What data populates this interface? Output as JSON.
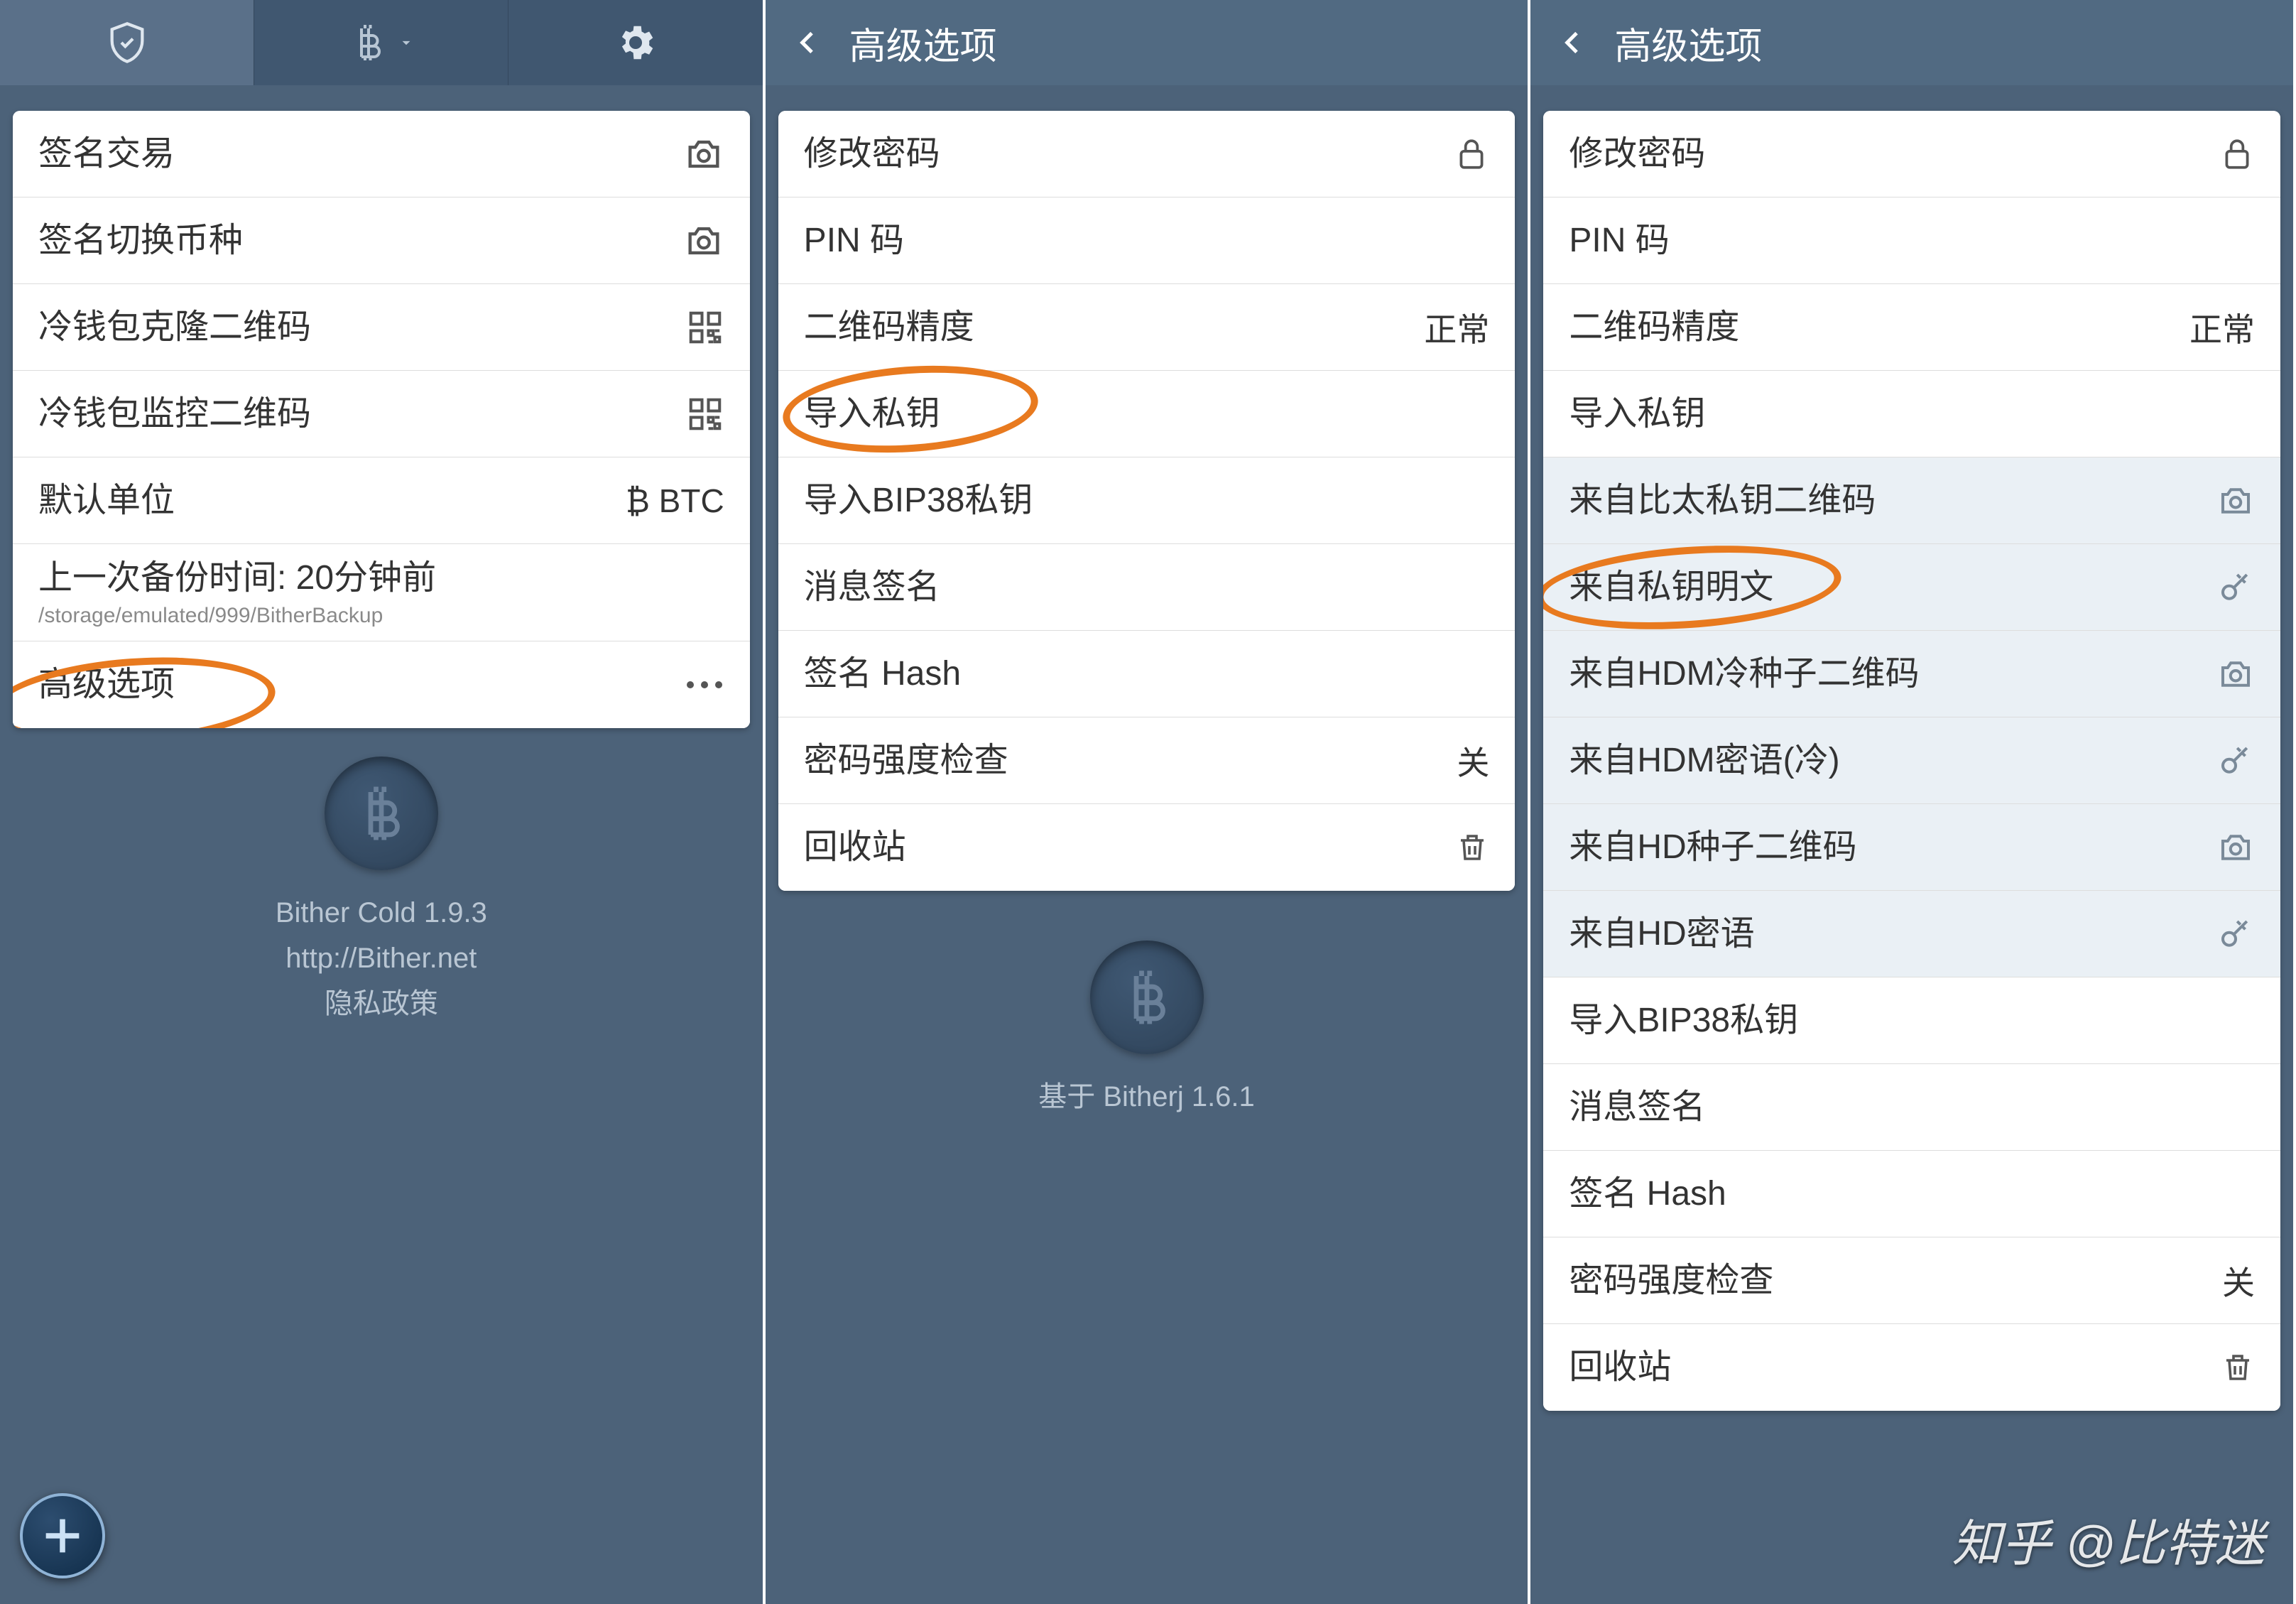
{
  "panel1": {
    "rows": [
      {
        "label": "签名交易",
        "icon": "camera"
      },
      {
        "label": "签名切换币种",
        "icon": "camera"
      },
      {
        "label": "冷钱包克隆二维码",
        "icon": "qr"
      },
      {
        "label": "冷钱包监控二维码",
        "icon": "qr"
      },
      {
        "label": "默认单位",
        "value": "₿ BTC"
      },
      {
        "label": "上一次备份时间: 20分钟前",
        "sublabel": "/storage/emulated/999/BitherBackup"
      },
      {
        "label": "高级选项",
        "icon": "dots"
      }
    ],
    "footer": {
      "app_name": "Bither Cold 1.9.3",
      "url": "http://Bither.net",
      "privacy": "隐私政策"
    }
  },
  "panel2": {
    "title": "高级选项",
    "rows": [
      {
        "label": "修改密码",
        "icon": "lock"
      },
      {
        "label": "PIN 码"
      },
      {
        "label": "二维码精度",
        "value": "正常"
      },
      {
        "label": "导入私钥"
      },
      {
        "label": "导入BIP38私钥"
      },
      {
        "label": "消息签名"
      },
      {
        "label": "签名 Hash"
      },
      {
        "label": "密码强度检查",
        "value": "关"
      },
      {
        "label": "回收站",
        "icon": "trash"
      }
    ],
    "footer": "基于 Bitherj 1.6.1"
  },
  "panel3": {
    "title": "高级选项",
    "rows": [
      {
        "label": "修改密码",
        "icon": "lock"
      },
      {
        "label": "PIN 码"
      },
      {
        "label": "二维码精度",
        "value": "正常"
      },
      {
        "label": "导入私钥"
      },
      {
        "label": "来自比太私钥二维码",
        "icon": "camera",
        "sub": true
      },
      {
        "label": "来自私钥明文",
        "icon": "key",
        "sub": true
      },
      {
        "label": "来自HDM冷种子二维码",
        "icon": "camera",
        "sub": true
      },
      {
        "label": "来自HDM密语(冷)",
        "icon": "key",
        "sub": true
      },
      {
        "label": "来自HD种子二维码",
        "icon": "camera",
        "sub": true
      },
      {
        "label": "来自HD密语",
        "icon": "key",
        "sub": true
      },
      {
        "label": "导入BIP38私钥"
      },
      {
        "label": "消息签名"
      },
      {
        "label": "签名 Hash"
      },
      {
        "label": "密码强度检查",
        "value": "关"
      },
      {
        "label": "回收站",
        "icon": "trash"
      }
    ]
  },
  "watermark": "知乎 @比特迷"
}
